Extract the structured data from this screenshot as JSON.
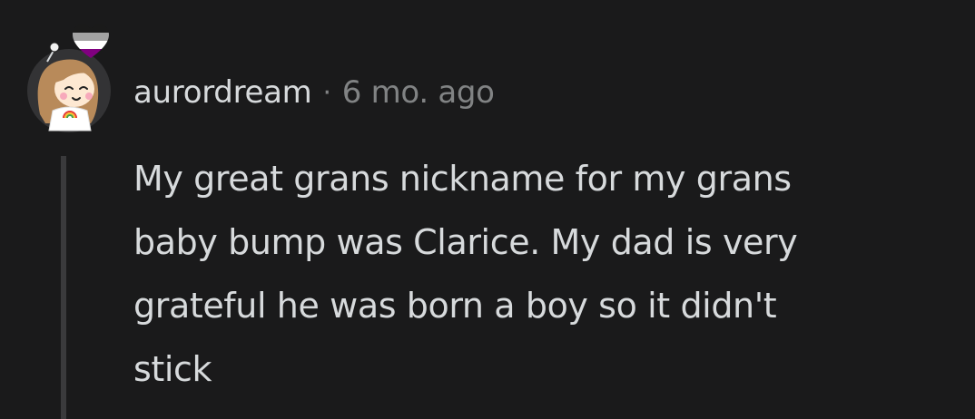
{
  "comment": {
    "author": "aurordream",
    "separator": "·",
    "time_ago": "6 mo. ago",
    "body": "My great grans nickname for my grans\nbaby bump was Clarice. My dad is very\ngrateful he was born a boy so it didn't\nstick"
  },
  "avatar": {
    "icon": "snoo-avatar-icon",
    "flair_icon": "ace-heart-flair-icon",
    "colors": {
      "flair_top": "#1a1a1a",
      "flair_grey": "#a3a3a3",
      "flair_white": "#ffffff",
      "flair_purple": "#800080",
      "hair": "#b88a5a",
      "skin": "#fde8d2",
      "background": "#333335"
    }
  },
  "theme": {
    "background": "#1a1a1b",
    "text_primary": "#d7dadc",
    "text_secondary": "#818384",
    "thread_line": "#3a3a3c"
  }
}
